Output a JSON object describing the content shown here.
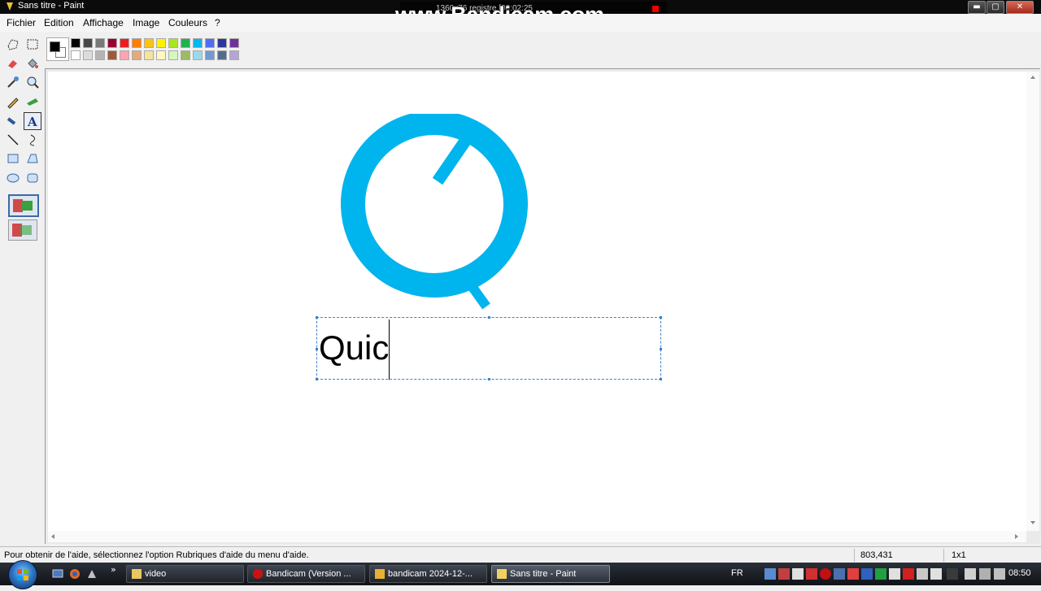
{
  "window": {
    "title": "Sans titre - Paint",
    "buttons": [
      {
        "name": "minimize-button",
        "glyph": "▬"
      },
      {
        "name": "maximize-button",
        "glyph": "▢"
      },
      {
        "name": "close-button",
        "glyph": "✕"
      }
    ]
  },
  "overlay": {
    "watermark": "www.Bandicam.com",
    "recording_info": "1360x76  registre  [00:02:25"
  },
  "menu": {
    "items": [
      "Fichier",
      "Edition",
      "Affichage",
      "Image",
      "Couleurs",
      "?"
    ]
  },
  "tools": [
    {
      "icon": "free-select-icon"
    },
    {
      "icon": "rect-select-icon"
    },
    {
      "icon": "eraser-icon"
    },
    {
      "icon": "fill-icon"
    },
    {
      "icon": "color-picker-icon"
    },
    {
      "icon": "magnifier-icon"
    },
    {
      "icon": "pencil-icon"
    },
    {
      "icon": "brush-icon"
    },
    {
      "icon": "airbrush-icon"
    },
    {
      "icon": "text-icon",
      "active": true
    },
    {
      "icon": "line-icon"
    },
    {
      "icon": "curve-icon"
    },
    {
      "icon": "rectangle-icon"
    },
    {
      "icon": "polygon-icon"
    },
    {
      "icon": "ellipse-icon"
    },
    {
      "icon": "rounded-rect-icon"
    }
  ],
  "palette": {
    "foreground": "#000000",
    "background": "#ffffff",
    "top_row": [
      "#000000",
      "#464646",
      "#787878",
      "#990030",
      "#ed1c24",
      "#ff7e00",
      "#ffc20e",
      "#fff200",
      "#a8e61d",
      "#22b14c",
      "#00b7ef",
      "#4d6df3",
      "#2f3699",
      "#6f3198"
    ],
    "bottom_row": [
      "#ffffff",
      "#dcdcdc",
      "#b4b4b4",
      "#9c5a3c",
      "#ffa3b1",
      "#e5aa7a",
      "#f5e49c",
      "#fff9bd",
      "#d3f9bc",
      "#9dbb61",
      "#99d9ea",
      "#709ad1",
      "#546d8e",
      "#b5a5d5"
    ]
  },
  "canvas": {
    "logo_color": "#00b4ee",
    "text_content": "Quic"
  },
  "status": {
    "help_text": "Pour obtenir de l'aide, sélectionnez l'option Rubriques d'aide du menu d'aide.",
    "coords": "803,431",
    "size": "1x1"
  },
  "taskbar": {
    "tasks": [
      {
        "label": "video",
        "icon": "folder-icon",
        "color": "#e8c860"
      },
      {
        "label": "Bandicam (Version ...",
        "icon": "bandicam-icon",
        "color": "#d01010"
      },
      {
        "label": "bandicam 2024-12-...",
        "icon": "media-file-icon",
        "color": "#e8b030"
      },
      {
        "label": "Sans titre - Paint",
        "icon": "paint-icon",
        "color": "#f0d060",
        "active": true
      }
    ],
    "language": "FR",
    "clock": "08:50"
  }
}
